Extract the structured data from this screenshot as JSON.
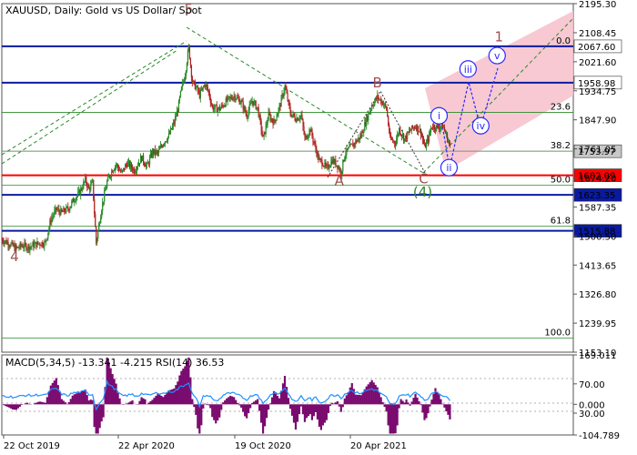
{
  "header": {
    "title": "XAUUSD, Daily:  Gold vs US Dollar/ Spot"
  },
  "chart_data": {
    "type": "candlestick",
    "symbol": "XAUUSD",
    "timeframe": "Daily",
    "description": "Gold vs US Dollar/ Spot",
    "y_axis_ticks": [
      "2195.30",
      "2108.45",
      "2021.60",
      "1934.75",
      "1847.90",
      "1761.05",
      "1674.20",
      "1587.35",
      "1500.50",
      "1413.65",
      "1326.80",
      "1239.95",
      "1153.10"
    ],
    "ylim": [
      1153.1,
      2195.3
    ],
    "x_axis_ticks": [
      "22 Oct 2019",
      "22 Apr 2020",
      "19 Oct 2020",
      "20 Apr 2021"
    ],
    "price_anchors": [
      [
        0,
        1490
      ],
      [
        8,
        1478
      ],
      [
        16,
        1463
      ],
      [
        22,
        1472
      ],
      [
        30,
        1468
      ],
      [
        40,
        1478
      ],
      [
        48,
        1480
      ],
      [
        54,
        1550
      ],
      [
        60,
        1580
      ],
      [
        66,
        1570
      ],
      [
        74,
        1585
      ],
      [
        80,
        1612
      ],
      [
        86,
        1632
      ],
      [
        92,
        1668
      ],
      [
        96,
        1640
      ],
      [
        100,
        1660
      ],
      [
        104,
        1480
      ],
      [
        110,
        1585
      ],
      [
        116,
        1662
      ],
      [
        122,
        1700
      ],
      [
        126,
        1715
      ],
      [
        132,
        1688
      ],
      [
        138,
        1718
      ],
      [
        146,
        1698
      ],
      [
        154,
        1735
      ],
      [
        160,
        1708
      ],
      [
        166,
        1752
      ],
      [
        172,
        1748
      ],
      [
        178,
        1780
      ],
      [
        184,
        1800
      ],
      [
        190,
        1840
      ],
      [
        194,
        1880
      ],
      [
        198,
        1940
      ],
      [
        202,
        1985
      ],
      [
        206,
        2065
      ],
      [
        210,
        1960
      ],
      [
        214,
        1945
      ],
      [
        218,
        1922
      ],
      [
        224,
        1955
      ],
      [
        228,
        1930
      ],
      [
        232,
        1885
      ],
      [
        240,
        1880
      ],
      [
        248,
        1905
      ],
      [
        256,
        1920
      ],
      [
        264,
        1900
      ],
      [
        270,
        1862
      ],
      [
        276,
        1905
      ],
      [
        282,
        1882
      ],
      [
        288,
        1790
      ],
      [
        294,
        1862
      ],
      [
        300,
        1840
      ],
      [
        306,
        1885
      ],
      [
        312,
        1948
      ],
      [
        318,
        1868
      ],
      [
        324,
        1852
      ],
      [
        330,
        1860
      ],
      [
        334,
        1790
      ],
      [
        340,
        1820
      ],
      [
        346,
        1760
      ],
      [
        350,
        1725
      ],
      [
        354,
        1720
      ],
      [
        358,
        1700
      ],
      [
        364,
        1728
      ],
      [
        370,
        1712
      ],
      [
        374,
        1690
      ],
      [
        378,
        1745
      ],
      [
        384,
        1765
      ],
      [
        390,
        1782
      ],
      [
        396,
        1800
      ],
      [
        402,
        1850
      ],
      [
        408,
        1892
      ],
      [
        414,
        1915
      ],
      [
        420,
        1900
      ],
      [
        424,
        1880
      ],
      [
        428,
        1790
      ],
      [
        434,
        1780
      ],
      [
        438,
        1820
      ],
      [
        444,
        1790
      ],
      [
        450,
        1815
      ],
      [
        456,
        1830
      ],
      [
        462,
        1812
      ],
      [
        466,
        1765
      ],
      [
        470,
        1790
      ],
      [
        474,
        1830
      ],
      [
        480,
        1825
      ],
      [
        486,
        1832
      ],
      [
        490,
        1800
      ],
      [
        494,
        1770
      ]
    ],
    "horizontal_levels": [
      {
        "label": "2067.60",
        "value": 2067.6,
        "style": "blue",
        "fill": "#ffffff",
        "text_color": "#000000"
      },
      {
        "label": "1958.98",
        "value": 1958.98,
        "style": "blue",
        "fill": "#ffffff",
        "text_color": "#000000"
      },
      {
        "label": "1753.97",
        "value": 1753.97,
        "style": "grey",
        "fill": "#c8c8c8",
        "text_color": "#000000"
      },
      {
        "label": "1682.09",
        "value": 1682.09,
        "style": "red",
        "fill": "#ff0000",
        "text_color": "#ffffff"
      },
      {
        "label": "1623.35",
        "value": 1623.35,
        "style": "blue",
        "fill": "#0a1aa0",
        "text_color": "#ffffff"
      },
      {
        "label": "1515.88",
        "value": 1515.88,
        "style": "blue",
        "fill": "#0a1aa0",
        "text_color": "#ffffff"
      }
    ],
    "fib_levels": [
      {
        "label": "0.0",
        "value": 2067.6
      },
      {
        "label": "23.6",
        "value": 1870.0
      },
      {
        "label": "38.2",
        "value": 1754.0
      },
      {
        "label": "50.0",
        "value": 1652.0
      },
      {
        "label": "61.8",
        "value": 1530.0
      },
      {
        "label": "100.0",
        "value": 1195.0
      }
    ],
    "wave_labels": [
      {
        "text": "5",
        "bar": 206,
        "value": 2165,
        "color": "#a05050"
      },
      {
        "text": "4",
        "bar": 14,
        "value": 1425,
        "color": "#a05050"
      },
      {
        "text": "A",
        "bar": 372,
        "value": 1652,
        "color": "#a05050"
      },
      {
        "text": "B",
        "bar": 414,
        "value": 1945,
        "color": "#a05050"
      },
      {
        "text": "C",
        "bar": 465,
        "value": 1658,
        "color": "#a05050"
      },
      {
        "text": "(4)",
        "bar": 464,
        "value": 1618,
        "color": "#2a8a2a"
      },
      {
        "text": "1",
        "bar": 548,
        "value": 2083,
        "color": "#a05050"
      }
    ],
    "forecast_labels": [
      {
        "text": "i",
        "bar": 482,
        "value": 1860
      },
      {
        "text": "ii",
        "bar": 493,
        "value": 1705
      },
      {
        "text": "iii",
        "bar": 514,
        "value": 2000
      },
      {
        "text": "iv",
        "bar": 528,
        "value": 1830
      },
      {
        "text": "v",
        "bar": 546,
        "value": 2040
      }
    ],
    "indicator_panel": {
      "title": "MACD(5,34,5) -13.341 -4.215 RSI(14) 36.53",
      "y_axis_ticks": [
        "169.011",
        "70.00",
        "0.000",
        "30.00",
        "-104.789"
      ]
    }
  }
}
